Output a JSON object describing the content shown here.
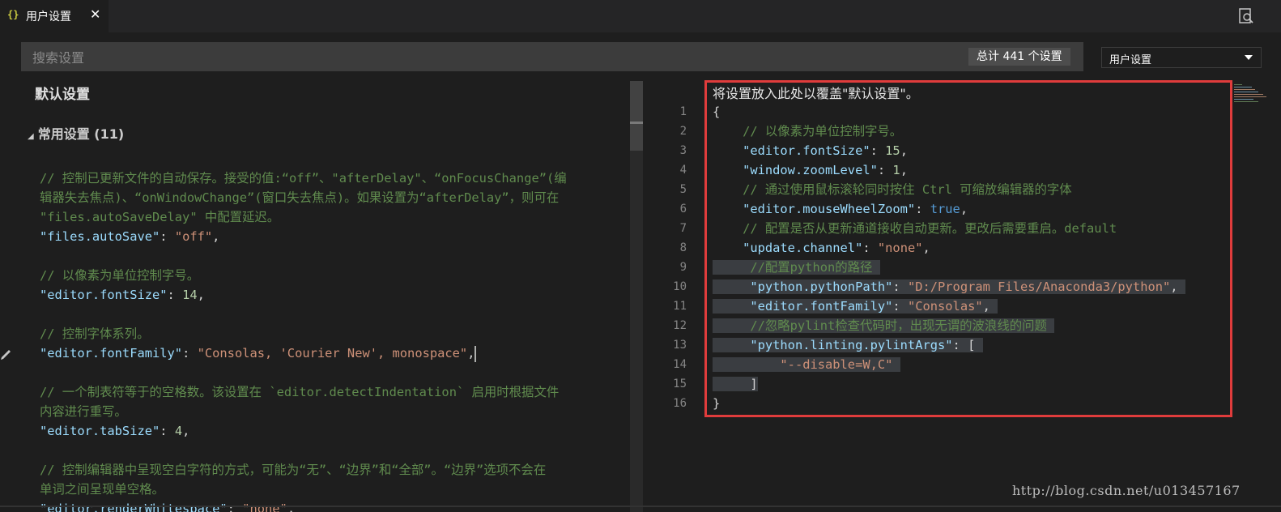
{
  "tab": {
    "icon": "{}",
    "title": "用户设置",
    "close": "✕"
  },
  "toolbar": {
    "open_json_icon": "search-document-icon"
  },
  "search": {
    "placeholder": "搜索设置",
    "count": "总计 441 个设置"
  },
  "scope_select": {
    "selected": "用户设置"
  },
  "left": {
    "title": "默认设置",
    "group": "常用设置 (11)",
    "lines": [
      [
        {
          "t": "// 控制已更新文件的自动保存。接受的值:“off”、\"afterDelay\"、“onFocusChange”(编",
          "c": "cmt"
        }
      ],
      [
        {
          "t": "辑器失去焦点)、“onWindowChange”(窗口失去焦点)。如果设置为“afterDelay”，则可在",
          "c": "cmt"
        }
      ],
      [
        {
          "t": "\"files.autoSaveDelay\" 中配置延迟。",
          "c": "cmt"
        }
      ],
      [
        {
          "t": "\"files.autoSave\"",
          "c": "key"
        },
        {
          "t": ": ",
          "c": "pun"
        },
        {
          "t": "\"off\"",
          "c": "str"
        },
        {
          "t": ",",
          "c": "pun"
        }
      ],
      [],
      [
        {
          "t": "// 以像素为单位控制字号。",
          "c": "cmt"
        }
      ],
      [
        {
          "t": "\"editor.fontSize\"",
          "c": "key"
        },
        {
          "t": ": ",
          "c": "pun"
        },
        {
          "t": "14",
          "c": "num"
        },
        {
          "t": ",",
          "c": "pun"
        }
      ],
      [],
      [
        {
          "t": "// 控制字体系列。",
          "c": "cmt"
        }
      ],
      [
        {
          "t": "\"editor.fontFamily\"",
          "c": "key"
        },
        {
          "t": ": ",
          "c": "pun"
        },
        {
          "t": "\"Consolas, 'Courier New', monospace\"",
          "c": "str"
        },
        {
          "t": ",",
          "c": "pun"
        },
        {
          "cursor": true
        }
      ],
      [],
      [
        {
          "t": "// 一个制表符等于的空格数。该设置在 `editor.detectIndentation` 启用时根据文件",
          "c": "cmt"
        }
      ],
      [
        {
          "t": "内容进行重写。",
          "c": "cmt"
        }
      ],
      [
        {
          "t": "\"editor.tabSize\"",
          "c": "key"
        },
        {
          "t": ": ",
          "c": "pun"
        },
        {
          "t": "4",
          "c": "num"
        },
        {
          "t": ",",
          "c": "pun"
        }
      ],
      [],
      [
        {
          "t": "// 控制编辑器中呈现空白字符的方式，可能为“无”、“边界”和“全部”。“边界”选项不会在",
          "c": "cmt"
        }
      ],
      [
        {
          "t": "单词之间呈现单空格。",
          "c": "cmt"
        }
      ],
      [
        {
          "t": "\"editor.renderWhitespace\"",
          "c": "key"
        },
        {
          "t": ": ",
          "c": "pun"
        },
        {
          "t": "\"none\"",
          "c": "str"
        },
        {
          "t": ",",
          "c": "pun"
        }
      ]
    ]
  },
  "right": {
    "notice": "将设置放入此处以覆盖\"默认设置\"。",
    "line_numbers": [
      "1",
      "2",
      "3",
      "4",
      "5",
      "6",
      "7",
      "8",
      "9",
      "10",
      "11",
      "12",
      "13",
      "14",
      "15",
      "16"
    ],
    "lines": [
      {
        "hl": 0,
        "tokens": [
          {
            "t": "{",
            "c": "pun"
          }
        ]
      },
      {
        "hl": 0,
        "tokens": [
          {
            "t": "    // 以像素为单位控制字号。",
            "c": "cmt"
          }
        ]
      },
      {
        "hl": 0,
        "tokens": [
          {
            "t": "    ",
            "c": "pun"
          },
          {
            "t": "\"editor.fontSize\"",
            "c": "key"
          },
          {
            "t": ": ",
            "c": "pun"
          },
          {
            "t": "15",
            "c": "num"
          },
          {
            "t": ",",
            "c": "pun"
          }
        ]
      },
      {
        "hl": 0,
        "tokens": [
          {
            "t": "    ",
            "c": "pun"
          },
          {
            "t": "\"window.zoomLevel\"",
            "c": "key"
          },
          {
            "t": ": ",
            "c": "pun"
          },
          {
            "t": "1",
            "c": "num"
          },
          {
            "t": ",",
            "c": "pun"
          }
        ]
      },
      {
        "hl": 0,
        "tokens": [
          {
            "t": "    // 通过使用鼠标滚轮同时按住 Ctrl 可缩放编辑器的字体",
            "c": "cmt"
          }
        ]
      },
      {
        "hl": 0,
        "tokens": [
          {
            "t": "    ",
            "c": "pun"
          },
          {
            "t": "\"editor.mouseWheelZoom\"",
            "c": "key"
          },
          {
            "t": ": ",
            "c": "pun"
          },
          {
            "t": "true",
            "c": "kw"
          },
          {
            "t": ",",
            "c": "pun"
          }
        ]
      },
      {
        "hl": 0,
        "tokens": [
          {
            "t": "    // 配置是否从更新通道接收自动更新。更改后需要重启。default",
            "c": "cmt"
          }
        ]
      },
      {
        "hl": 0,
        "tokens": [
          {
            "t": "    ",
            "c": "pun"
          },
          {
            "t": "\"update.channel\"",
            "c": "key"
          },
          {
            "t": ": ",
            "c": "pun"
          },
          {
            "t": "\"none\"",
            "c": "str"
          },
          {
            "t": ",",
            "c": "pun"
          }
        ]
      },
      {
        "hl": 1,
        "tokens": [
          {
            "t": "     //配置python的路径 ",
            "c": "cmt"
          }
        ]
      },
      {
        "hl": 1,
        "tokens": [
          {
            "t": "     ",
            "c": "pun"
          },
          {
            "t": "\"python.pythonPath\"",
            "c": "key"
          },
          {
            "t": ": ",
            "c": "pun"
          },
          {
            "t": "\"D:/Program Files/Anaconda3/python\"",
            "c": "str"
          },
          {
            "t": ", ",
            "c": "pun"
          }
        ]
      },
      {
        "hl": 1,
        "tokens": [
          {
            "t": "     ",
            "c": "pun"
          },
          {
            "t": "\"editor.fontFamily\"",
            "c": "key"
          },
          {
            "t": ": ",
            "c": "pun"
          },
          {
            "t": "\"Consolas\"",
            "c": "str"
          },
          {
            "t": ", ",
            "c": "pun"
          }
        ]
      },
      {
        "hl": 1,
        "tokens": [
          {
            "t": "     //忽略pylint检查代码时，出现无谓的波浪线的问题 ",
            "c": "cmt"
          }
        ]
      },
      {
        "hl": 1,
        "tokens": [
          {
            "t": "     ",
            "c": "pun"
          },
          {
            "t": "\"python.linting.pylintArgs\"",
            "c": "key"
          },
          {
            "t": ": [ ",
            "c": "pun"
          }
        ]
      },
      {
        "hl": 1,
        "tokens": [
          {
            "t": "         ",
            "c": "pun"
          },
          {
            "t": "\"--disable=W,C\"",
            "c": "str"
          },
          {
            "t": " ",
            "c": "pun"
          }
        ]
      },
      {
        "hl": 1,
        "tokens": [
          {
            "t": "     ]",
            "c": "pun"
          }
        ]
      },
      {
        "hl": 0,
        "tokens": [
          {
            "t": "}",
            "c": "pun"
          }
        ]
      }
    ]
  },
  "watermark": "http://blog.csdn.net/u013457167",
  "colors": {
    "comment": "#608b4e",
    "key": "#9cdcfe",
    "string": "#ce9178",
    "number": "#b5cea8",
    "keyword": "#569cd6",
    "highlight_box": "#e03c3c"
  }
}
